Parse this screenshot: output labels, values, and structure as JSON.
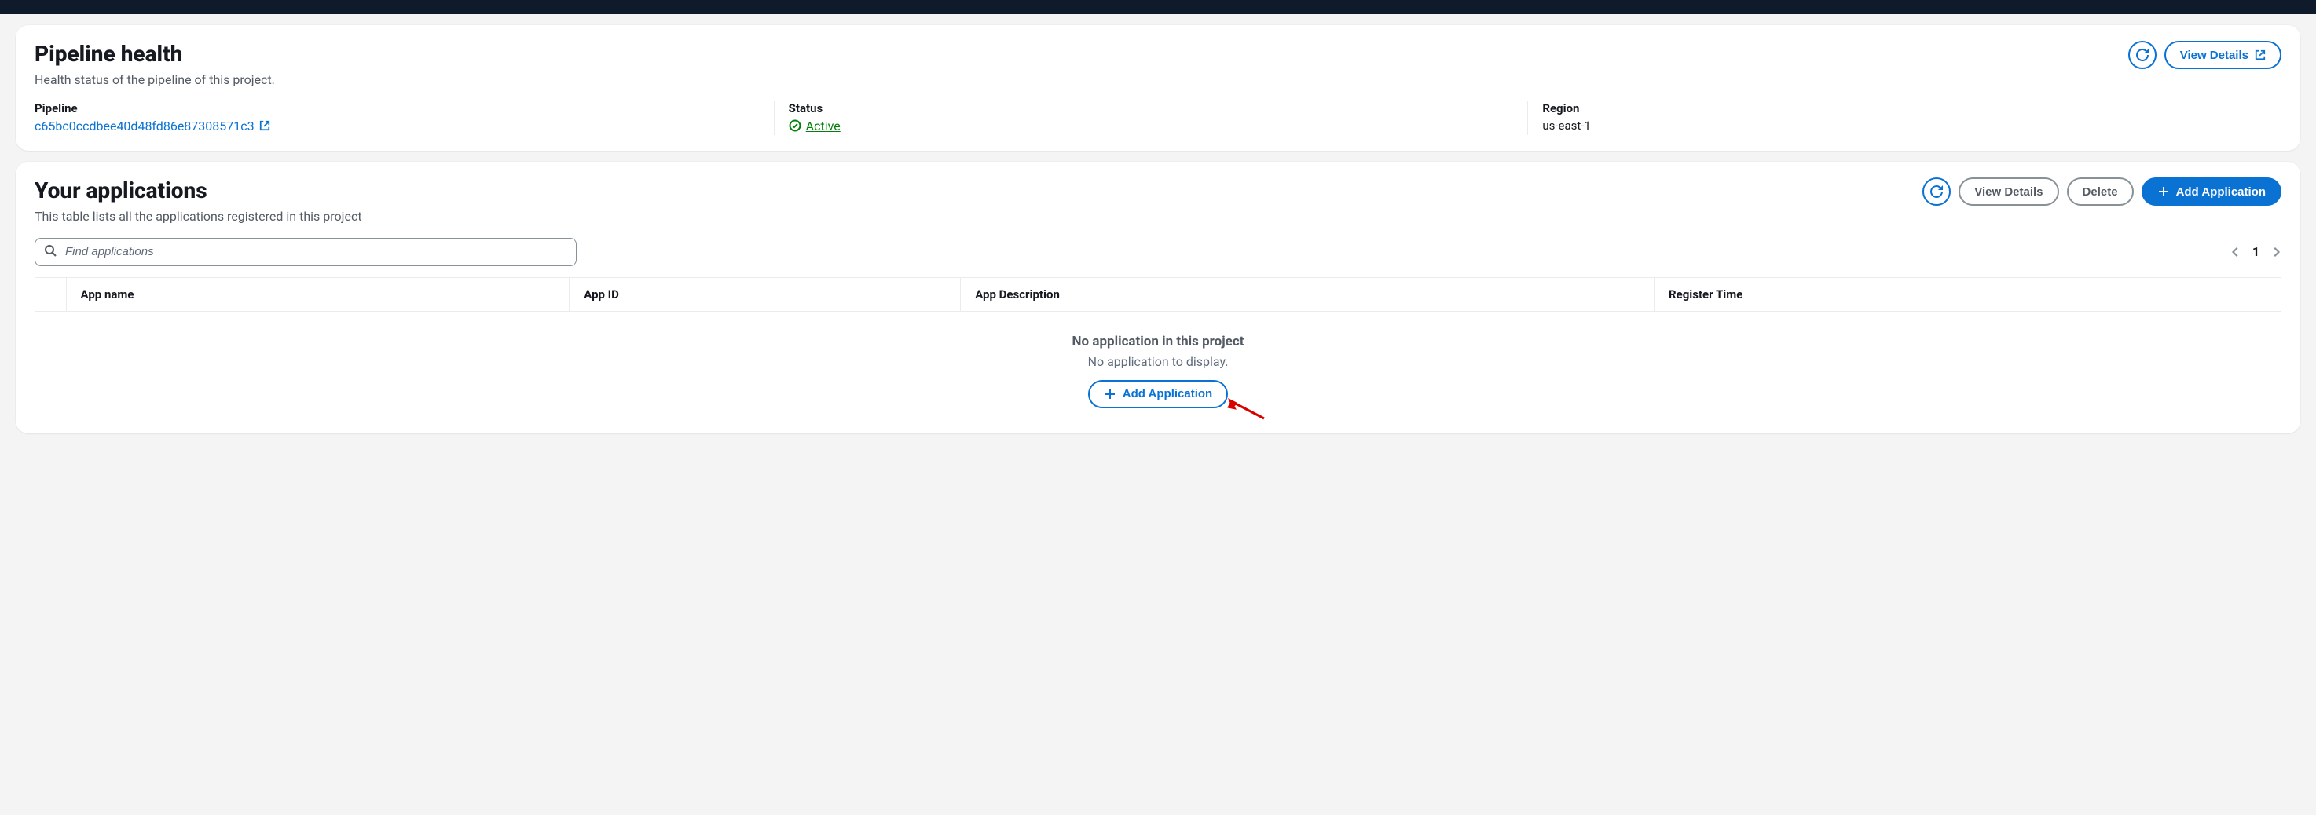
{
  "pipeline_health": {
    "title": "Pipeline health",
    "subtitle": "Health status of the pipeline of this project.",
    "view_details_label": "View Details",
    "fields": {
      "pipeline": {
        "label": "Pipeline",
        "value": "c65bc0ccdbee40d48fd86e87308571c3"
      },
      "status": {
        "label": "Status",
        "value": "Active"
      },
      "region": {
        "label": "Region",
        "value": "us-east-1"
      }
    }
  },
  "applications": {
    "title": "Your applications",
    "subtitle": "This table lists all the applications registered in this project",
    "view_details_label": "View Details",
    "delete_label": "Delete",
    "add_label": "Add Application",
    "search_placeholder": "Find applications",
    "page": "1",
    "columns": {
      "name": "App name",
      "id": "App ID",
      "desc": "App Description",
      "time": "Register Time"
    },
    "empty": {
      "title": "No application in this project",
      "subtitle": "No application to display.",
      "add_label": "Add Application"
    }
  }
}
